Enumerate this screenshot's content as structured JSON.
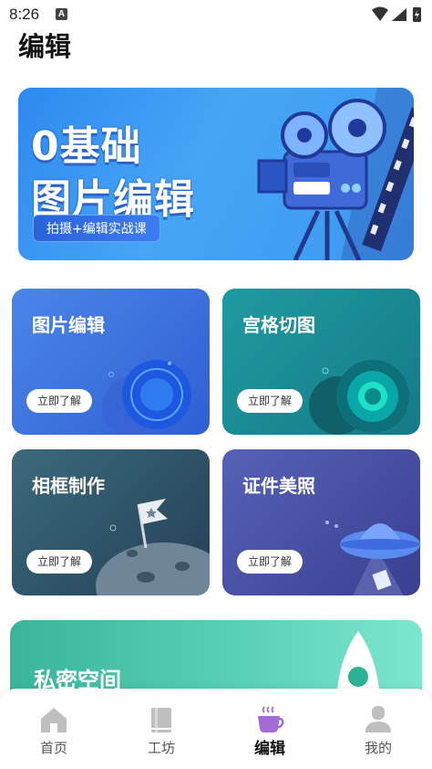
{
  "status": {
    "time": "8:26",
    "notification_letter": "A"
  },
  "page": {
    "title": "编辑"
  },
  "banner": {
    "title_line1": "0基础",
    "title_line2": "图片编辑",
    "pill": "拍摄+编辑实战课"
  },
  "cards": [
    {
      "title": "图片编辑",
      "button": "立即了解"
    },
    {
      "title": "宫格切图",
      "button": "立即了解"
    },
    {
      "title": "相框制作",
      "button": "立即了解"
    },
    {
      "title": "证件美照",
      "button": "立即了解"
    }
  ],
  "private_space": {
    "title": "私密空间"
  },
  "tabbar": {
    "items": [
      {
        "label": "首页",
        "icon": "home-icon"
      },
      {
        "label": "工坊",
        "icon": "book-icon"
      },
      {
        "label": "编辑",
        "icon": "coffee-cup-icon",
        "active": true
      },
      {
        "label": "我的",
        "icon": "user-icon"
      }
    ],
    "active_color": "#a36bd6"
  }
}
